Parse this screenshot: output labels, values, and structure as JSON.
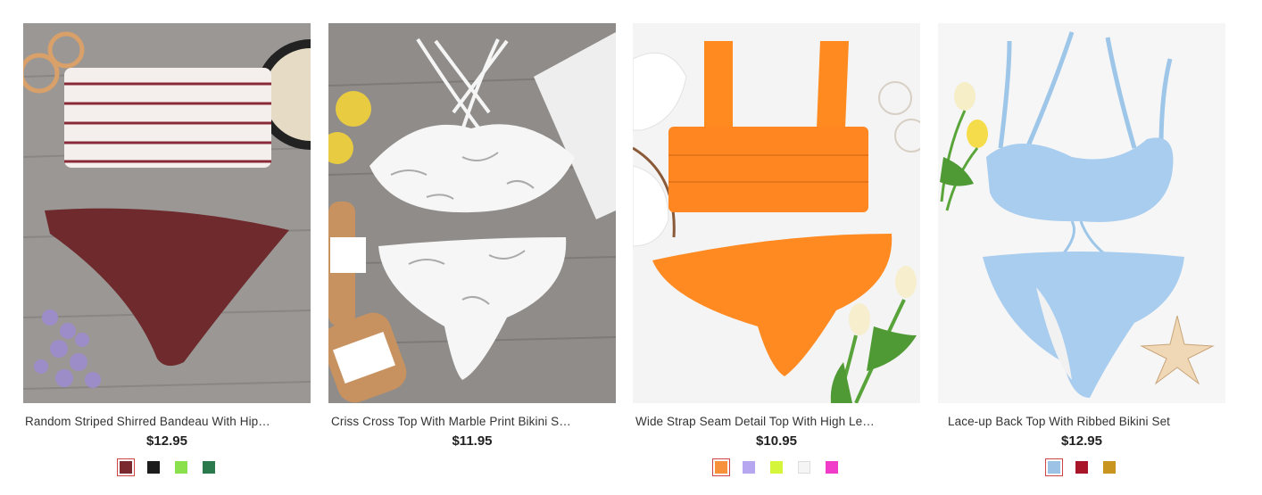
{
  "products": [
    {
      "title": "Random Striped Shirred Bandeau With Hip…",
      "price": "$12.95",
      "image": "burgundy-striped-bandeau-bikini-photo",
      "swatches": [
        {
          "color": "#7a2a2e",
          "selected": true
        },
        {
          "color": "#1c1c1c",
          "selected": false
        },
        {
          "color": "#8be04e",
          "selected": false
        },
        {
          "color": "#2a7a4e",
          "selected": false
        }
      ]
    },
    {
      "title": "Criss Cross Top With Marble Print Bikini S…",
      "price": "$11.95",
      "image": "white-marble-bikini-photo",
      "swatches": []
    },
    {
      "title": "Wide Strap Seam Detail Top With High Le…",
      "price": "$10.95",
      "image": "neon-orange-bikini-photo",
      "swatches": [
        {
          "color": "#f7913a",
          "selected": true
        },
        {
          "color": "#b7a6f0",
          "selected": false
        },
        {
          "color": "#d5f53a",
          "selected": false
        },
        {
          "color": "#f5f5f5",
          "selected": false,
          "light": true
        },
        {
          "color": "#f03cc8",
          "selected": false
        }
      ]
    },
    {
      "title": "Lace-up Back Top With Ribbed Bikini Set",
      "price": "$12.95",
      "image": "light-blue-ribbed-bikini-photo",
      "swatches": [
        {
          "color": "#9cc3e6",
          "selected": true
        },
        {
          "color": "#a8162a",
          "selected": false
        },
        {
          "color": "#c8961e",
          "selected": false
        }
      ]
    }
  ]
}
